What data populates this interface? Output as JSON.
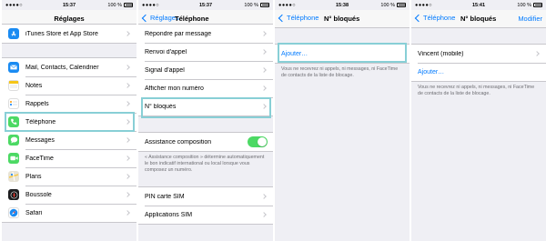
{
  "status": {
    "carrier": "●●●●○",
    "battery": "100 %"
  },
  "screen1": {
    "time": "15:37",
    "title": "Réglages",
    "top_item": "iTunes Store et App Store",
    "items": [
      {
        "label": "Mail, Contacts, Calendrier",
        "icon": "mail-icon"
      },
      {
        "label": "Notes",
        "icon": "notes-icon"
      },
      {
        "label": "Rappels",
        "icon": "reminders-icon"
      },
      {
        "label": "Téléphone",
        "icon": "phone-icon"
      },
      {
        "label": "Messages",
        "icon": "messages-icon"
      },
      {
        "label": "FaceTime",
        "icon": "facetime-icon"
      },
      {
        "label": "Plans",
        "icon": "maps-icon"
      },
      {
        "label": "Boussole",
        "icon": "compass-icon"
      },
      {
        "label": "Safari",
        "icon": "safari-icon"
      }
    ]
  },
  "screen2": {
    "time": "15:37",
    "back": "Réglages",
    "title": "Téléphone",
    "items": [
      "Répondre par message",
      "Renvoi d'appel",
      "Signal d'appel",
      "Afficher mon numéro",
      "N° bloqués"
    ],
    "assist_label": "Assistance composition",
    "assist_on": true,
    "assist_note": "« Assistance composition » détermine automatiquement le bon indicatif international ou local lorsque vous composez un numéro.",
    "sim_items": [
      "PIN carte SIM",
      "Applications SIM"
    ]
  },
  "screen3": {
    "time": "15:38",
    "back": "Téléphone",
    "title": "N° bloqués",
    "add": "Ajouter…",
    "note": "Vous ne recevrez ni appels, ni messages, ni FaceTime de contacts de la liste de blocage."
  },
  "screen4": {
    "time": "15:41",
    "back": "Téléphone",
    "title": "N° bloqués",
    "edit": "Modifier",
    "contact": "Vincent (mobile)",
    "add": "Ajouter…",
    "note": "Vous ne recevrez ni appels, ni messages, ni FaceTime de contacts de la liste de blocage."
  },
  "colors": {
    "accent": "#007aff",
    "highlight": "#88cfd6",
    "switch_on": "#4cd964"
  }
}
